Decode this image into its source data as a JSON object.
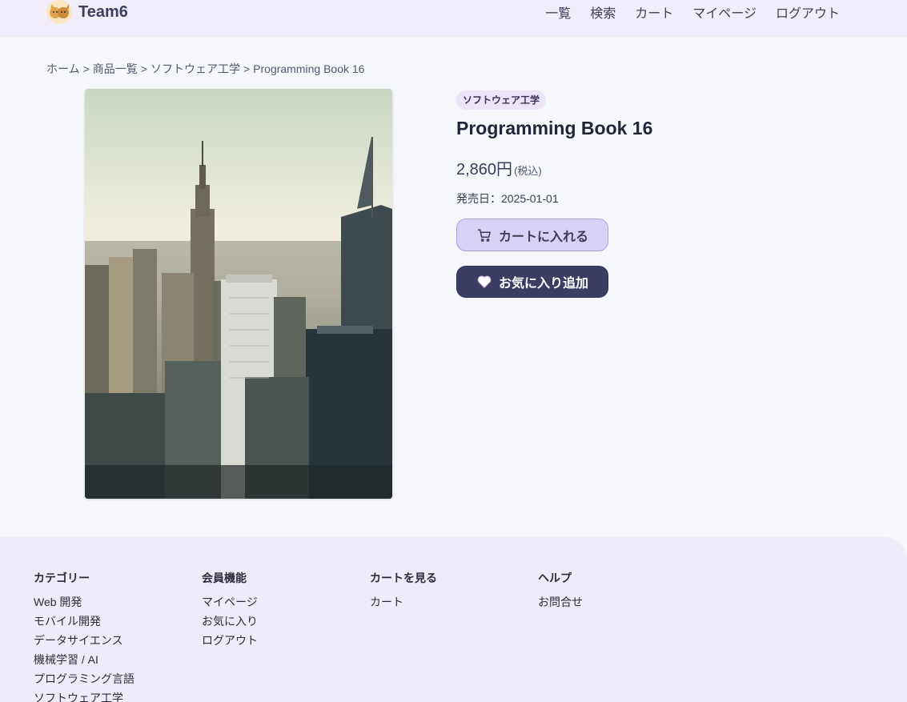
{
  "header": {
    "brand": "Team6",
    "nav": [
      "一覧",
      "検索",
      "カート",
      "マイページ",
      "ログアウト"
    ]
  },
  "breadcrumb": [
    "ホーム",
    "商品一覧",
    "ソフトウェア工学",
    "Programming Book 16"
  ],
  "breadcrumb_separator": ">",
  "product": {
    "category": "ソフトウェア工学",
    "title": "Programming Book 16",
    "price": "2,860円",
    "tax_note": "(税込)",
    "release": "発売日：2025-01-01",
    "add_to_cart": "カートに入れる",
    "add_favorite": "お気に入り追加"
  },
  "footer": {
    "columns": [
      {
        "heading": "カテゴリー",
        "items": [
          "Web 開発",
          "モバイル開発",
          "データサイエンス",
          "機械学習 / AI",
          "プログラミング言語",
          "ソフトウェア工学"
        ]
      },
      {
        "heading": "会員機能",
        "items": [
          "マイページ",
          "お気に入り",
          "ログアウト"
        ]
      },
      {
        "heading": "カートを見る",
        "items": [
          "カート"
        ]
      },
      {
        "heading": "ヘルプ",
        "items": [
          "お問合せ"
        ]
      }
    ]
  },
  "icons": {
    "logo": "cat-logo-icon",
    "cart": "cart-icon",
    "favorite": "heart-icon"
  },
  "colors": {
    "header_bg": "#f1edfb",
    "cart_button": "#d9d2f6",
    "favorite_button": "#3c3d63",
    "badge_bg": "#ece5fa"
  }
}
